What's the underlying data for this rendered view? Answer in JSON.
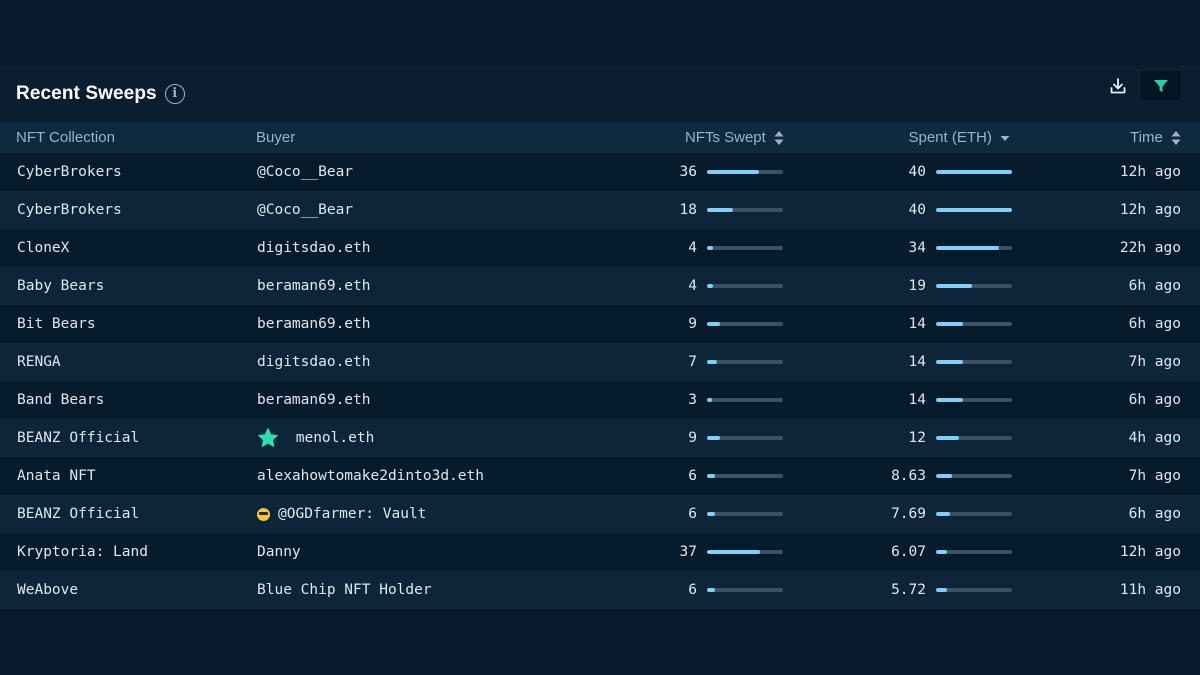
{
  "header": {
    "title": "Recent Sweeps",
    "info_icon": "info-icon",
    "download_icon": "download-icon",
    "filter_icon": "filter-icon",
    "accent_color": "#22d3a5"
  },
  "table": {
    "columns": {
      "collection": "NFT Collection",
      "buyer": "Buyer",
      "nfts_swept": "NFTs Swept",
      "spent": "Spent (ETH)",
      "time": "Time"
    },
    "sort": {
      "nfts_swept": "unsorted",
      "spent": "descending",
      "time": "unsorted"
    },
    "rows": [
      {
        "collection": "CyberBrokers",
        "buyer": "@Coco__Bear",
        "buyer_icon": "",
        "nfts": "36",
        "nfts_frac": 0.68,
        "spent": "40",
        "spent_frac": 1.0,
        "time": "12h ago"
      },
      {
        "collection": "CyberBrokers",
        "buyer": "@Coco__Bear",
        "buyer_icon": "",
        "nfts": "18",
        "nfts_frac": 0.34,
        "spent": "40",
        "spent_frac": 1.0,
        "time": "12h ago"
      },
      {
        "collection": "CloneX",
        "buyer": "digitsdao.eth",
        "buyer_icon": "",
        "nfts": "4",
        "nfts_frac": 0.08,
        "spent": "34",
        "spent_frac": 0.83,
        "time": "22h ago"
      },
      {
        "collection": "Baby Bears",
        "buyer": "beraman69.eth",
        "buyer_icon": "",
        "nfts": "4",
        "nfts_frac": 0.08,
        "spent": "19",
        "spent_frac": 0.47,
        "time": "6h ago"
      },
      {
        "collection": "Bit Bears",
        "buyer": "beraman69.eth",
        "buyer_icon": "",
        "nfts": "9",
        "nfts_frac": 0.17,
        "spent": "14",
        "spent_frac": 0.35,
        "time": "6h ago"
      },
      {
        "collection": "RENGA",
        "buyer": "digitsdao.eth",
        "buyer_icon": "",
        "nfts": "7",
        "nfts_frac": 0.13,
        "spent": "14",
        "spent_frac": 0.35,
        "time": "7h ago"
      },
      {
        "collection": "Band Bears",
        "buyer": "beraman69.eth",
        "buyer_icon": "",
        "nfts": "3",
        "nfts_frac": 0.06,
        "spent": "14",
        "spent_frac": 0.35,
        "time": "6h ago"
      },
      {
        "collection": "BEANZ Official",
        "buyer": "menol.eth",
        "buyer_icon": "star-icon",
        "nfts": "9",
        "nfts_frac": 0.17,
        "spent": "12",
        "spent_frac": 0.3,
        "time": "4h ago"
      },
      {
        "collection": "Anata NFT",
        "buyer": "alexahowtomake2dinto3d.eth",
        "buyer_icon": "",
        "nfts": "6",
        "nfts_frac": 0.11,
        "spent": "8.63",
        "spent_frac": 0.21,
        "time": "7h ago"
      },
      {
        "collection": "BEANZ Official",
        "buyer": "@OGDfarmer: Vault",
        "buyer_icon": "sunglasses-emoji-icon",
        "nfts": "6",
        "nfts_frac": 0.11,
        "spent": "7.69",
        "spent_frac": 0.19,
        "time": "6h ago"
      },
      {
        "collection": "Kryptoria: Land",
        "buyer": "Danny",
        "buyer_icon": "",
        "nfts": "37",
        "nfts_frac": 0.7,
        "spent": "6.07",
        "spent_frac": 0.15,
        "time": "12h ago"
      },
      {
        "collection": "WeAbove",
        "buyer": "Blue Chip NFT Holder",
        "buyer_icon": "",
        "nfts": "6",
        "nfts_frac": 0.11,
        "spent": "5.72",
        "spent_frac": 0.14,
        "time": "11h ago"
      }
    ]
  }
}
